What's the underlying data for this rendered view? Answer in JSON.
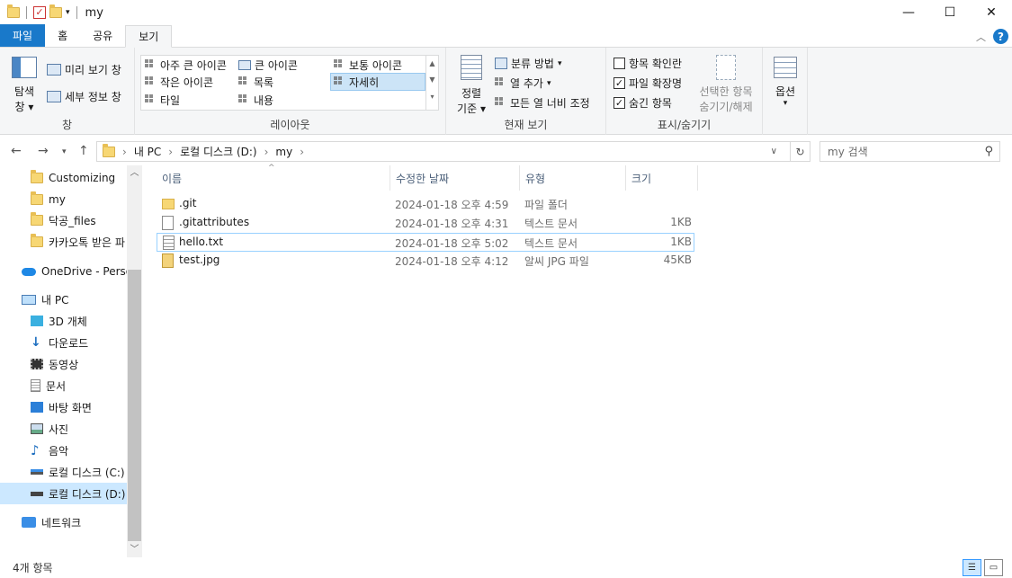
{
  "window": {
    "title": "my",
    "minimize": "—",
    "maximize": "☐",
    "close": "✕"
  },
  "ribbon_tabs": [
    "파일",
    "홈",
    "공유",
    "보기"
  ],
  "ribbon": {
    "panes": {
      "nav_pane": "탐색",
      "nav_pane2": "창",
      "preview": "미리 보기 창",
      "details": "세부 정보 창",
      "label": "창"
    },
    "layout": {
      "items": [
        "아주 큰 아이콘",
        "큰 아이콘",
        "보통 아이콘",
        "작은 아이콘",
        "목록",
        "자세히",
        "타일",
        "내용"
      ],
      "label": "레이아웃"
    },
    "current_view": {
      "sort": "정렬",
      "sort2": "기준",
      "group_by": "분류 방법",
      "add_column": "열 추가",
      "fit_columns": "모든 열 너비 조정",
      "label": "현재 보기"
    },
    "show_hide": {
      "item_checkboxes": "항목 확인란",
      "file_extensions": "파일 확장명",
      "hidden_items": "숨긴 항목",
      "hide_selected1": "선택한 항목",
      "hide_selected2": "숨기기/해제",
      "label": "표시/숨기기"
    },
    "options": "옵션"
  },
  "address": {
    "crumbs": [
      "내 PC",
      "로컬 디스크 (D:)",
      "my"
    ],
    "search_placeholder": "my 검색"
  },
  "nav_pane": {
    "items": [
      "Customizing",
      "my",
      "닥공_files",
      "카카오톡 받은 파",
      "OneDrive - Person",
      "내 PC",
      "3D 개체",
      "다운로드",
      "동영상",
      "문서",
      "바탕 화면",
      "사진",
      "음악",
      "로컬 디스크 (C:)",
      "로컬 디스크 (D:)",
      "네트워크"
    ]
  },
  "columns": [
    "이름",
    "수정한 날짜",
    "유형",
    "크기"
  ],
  "files": [
    {
      "name": ".git",
      "date": "2024-01-18 오후 4:59",
      "type": "파일 폴더",
      "size": ""
    },
    {
      "name": ".gitattributes",
      "date": "2024-01-18 오후 4:31",
      "type": "텍스트 문서",
      "size": "1KB"
    },
    {
      "name": "hello.txt",
      "date": "2024-01-18 오후 5:02",
      "type": "텍스트 문서",
      "size": "1KB"
    },
    {
      "name": "test.jpg",
      "date": "2024-01-18 오후 4:12",
      "type": "알씨 JPG 파일",
      "size": "45KB"
    }
  ],
  "status": {
    "count": "4개 항목"
  },
  "colors": {
    "accent": "#1979ca",
    "selection": "#cce8ff",
    "folder": "#f7d774"
  }
}
